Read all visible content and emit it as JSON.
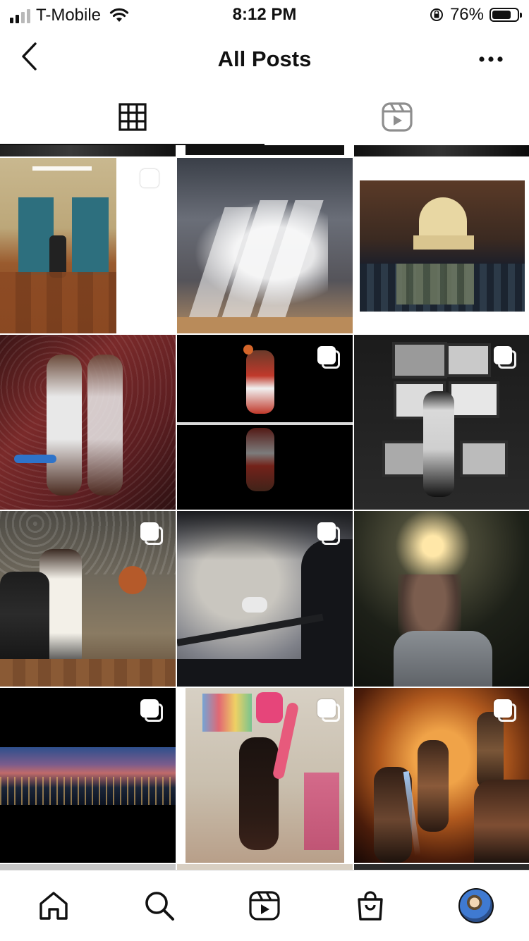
{
  "status_bar": {
    "carrier": "T-Mobile",
    "time": "8:12 PM",
    "battery_percent": "76%",
    "battery_level": 0.76,
    "signal_bars_active": 2,
    "signal_bars_total": 4
  },
  "header": {
    "title": "All Posts",
    "back_icon": "chevron-left-icon",
    "more_icon": "more-horizontal-icon"
  },
  "tabs": [
    {
      "name": "posts-grid",
      "icon": "grid-icon",
      "active": true
    },
    {
      "name": "reels",
      "icon": "reels-icon",
      "active": false
    }
  ],
  "posts": [
    {
      "row": 1,
      "col": 1,
      "subject": "elevator-lobby-dancer",
      "multiple": true
    },
    {
      "row": 1,
      "col": 2,
      "subject": "pitcher-multi-exposure",
      "multiple": false
    },
    {
      "row": 1,
      "col": 3,
      "subject": "capitol-snow-soldiers",
      "multiple": false
    },
    {
      "row": 2,
      "col": 1,
      "subject": "basketball-player-reflection",
      "multiple": false
    },
    {
      "row": 2,
      "col": 2,
      "subject": "dunk-reflection-dark",
      "multiple": true
    },
    {
      "row": 2,
      "col": 3,
      "subject": "woman-with-tvs",
      "multiple": true
    },
    {
      "row": 3,
      "col": 1,
      "subject": "basketball-game-crowd",
      "multiple": true
    },
    {
      "row": 3,
      "col": 2,
      "subject": "heron-spanish-moss",
      "multiple": true
    },
    {
      "row": 3,
      "col": 3,
      "subject": "girl-night-light",
      "multiple": false
    },
    {
      "row": 4,
      "col": 1,
      "subject": "city-skyline-panorama",
      "multiple": true
    },
    {
      "row": 4,
      "col": 2,
      "subject": "long-hair-room",
      "multiple": true
    },
    {
      "row": 4,
      "col": 3,
      "subject": "firefighters-night",
      "multiple": true
    }
  ],
  "bottom_nav": [
    {
      "name": "home",
      "icon": "home-icon"
    },
    {
      "name": "search",
      "icon": "search-icon"
    },
    {
      "name": "reels",
      "icon": "reels-icon"
    },
    {
      "name": "shop",
      "icon": "shopping-bag-icon"
    },
    {
      "name": "profile",
      "icon": "avatar"
    }
  ],
  "colors": {
    "text": "#111111",
    "inactive_icon": "#8e8e8e",
    "background": "#ffffff"
  }
}
